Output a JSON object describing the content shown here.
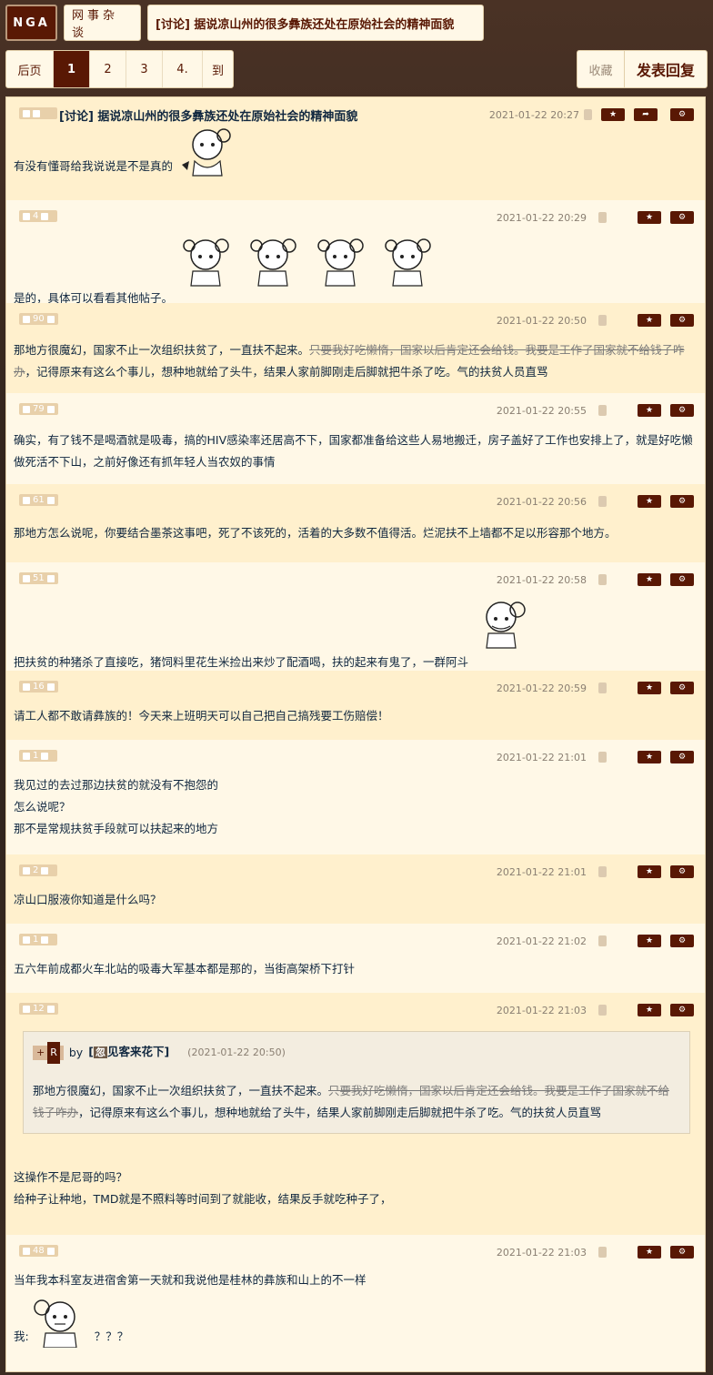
{
  "header": {
    "logo": "NGA",
    "forum": "网事杂谈",
    "thread_title": "[讨论] 据说凉山州的很多彝族还处在原始社会的精神面貌"
  },
  "pager": {
    "items": [
      "后页",
      "1",
      "2",
      "3",
      "4.",
      "到"
    ],
    "active": "1"
  },
  "actions": {
    "favorite": "收藏",
    "reply": "发表回复"
  },
  "posts": [
    {
      "votes": "",
      "title": "[讨论] 据说凉山州的很多彝族还处在原始社会的精神面貌",
      "date": "2021-01-22 20:27",
      "text": "有没有懂哥给我说说是不是真的",
      "stickers": 1
    },
    {
      "votes": "4",
      "date": "2021-01-22 20:29",
      "text": "是的，具体可以看看其他帖子。",
      "stickers": 4
    },
    {
      "votes": "90",
      "date": "2021-01-22 20:50",
      "text_a": "那地方很魔幻，国家不止一次组织扶贫了，一直扶不起来。",
      "text_strike_a": "只要我好吃懒惰，国家以后肯定还会给钱。我要是工作了国家就不给钱子咋办",
      "text_b": "，记得原来有这么个事儿，想种地就给了头牛，结果人家前脚刚走后脚就把牛杀了吃。气的扶贫人员直骂"
    },
    {
      "votes": "79",
      "date": "2021-01-22 20:55",
      "text": "确实，有了钱不是喝酒就是吸毒，搞的HIV感染率还居高不下，国家都准备给这些人易地搬迁，房子盖好了工作也安排上了，就是好吃懒做死活不下山，之前好像还有抓年轻人当农奴的事情"
    },
    {
      "votes": "61",
      "date": "2021-01-22 20:56",
      "text": "那地方怎么说呢，你要结合墨茶这事吧，死了不该死的，活着的大多数不值得活。烂泥扶不上墙都不足以形容那个地方。"
    },
    {
      "votes": "51",
      "date": "2021-01-22 20:58",
      "text": "把扶贫的种猪杀了直接吃，猪饲料里花生米捡出来炒了配酒喝，扶的起来有鬼了，一群阿斗"
    },
    {
      "votes": "16",
      "date": "2021-01-22 20:59",
      "text": "请工人都不敢请彝族的！今天来上班明天可以自己把自己搞残要工伤赔偿！"
    },
    {
      "votes": "1",
      "date": "2021-01-22 21:01",
      "lines": [
        "我见过的去过那边扶贫的就没有不抱怨的",
        "怎么说呢？",
        "那不是常规扶贫手段就可以扶起来的地方"
      ]
    },
    {
      "votes": "2",
      "date": "2021-01-22 21:01",
      "text": "凉山口服液你知道是什么吗？"
    },
    {
      "votes": "1",
      "date": "2021-01-22 21:02",
      "text": "五六年前成都火车北站的吸毒大军基本都是那的，当街高架桥下打针"
    },
    {
      "votes": "12",
      "date": "2021-01-22 21:03",
      "quote": {
        "tag_plus": "+",
        "tag_r": "R",
        "by": "by",
        "avatar": "忽",
        "user": "见客来花下]",
        "bracket": "[",
        "date": "(2021-01-22 20:50)",
        "text_a": "那地方很魔幻，国家不止一次组织扶贫了，一直扶不起来。",
        "text_strike": "只要我好吃懒惰，国家以后肯定还会给钱。我要是工作了国家就不给钱子咋办",
        "text_b": "，记得原来有这么个事儿，想种地就给了头牛，结果人家前脚刚走后脚就把牛杀了吃。气的扶贫人员直骂"
      },
      "lines": [
        "这操作不是尼哥的吗？",
        "给种子让种地，TMD就是不照料等时间到了就能收，结果反手就吃种子了，"
      ]
    },
    {
      "votes": "48",
      "date": "2021-01-22 21:03",
      "text": "当年我本科室友进宿舍第一天就和我说他是桂林的彝族和山上的不一样",
      "text2_prefix": "我:",
      "text2_suffix": "？？？"
    }
  ]
}
